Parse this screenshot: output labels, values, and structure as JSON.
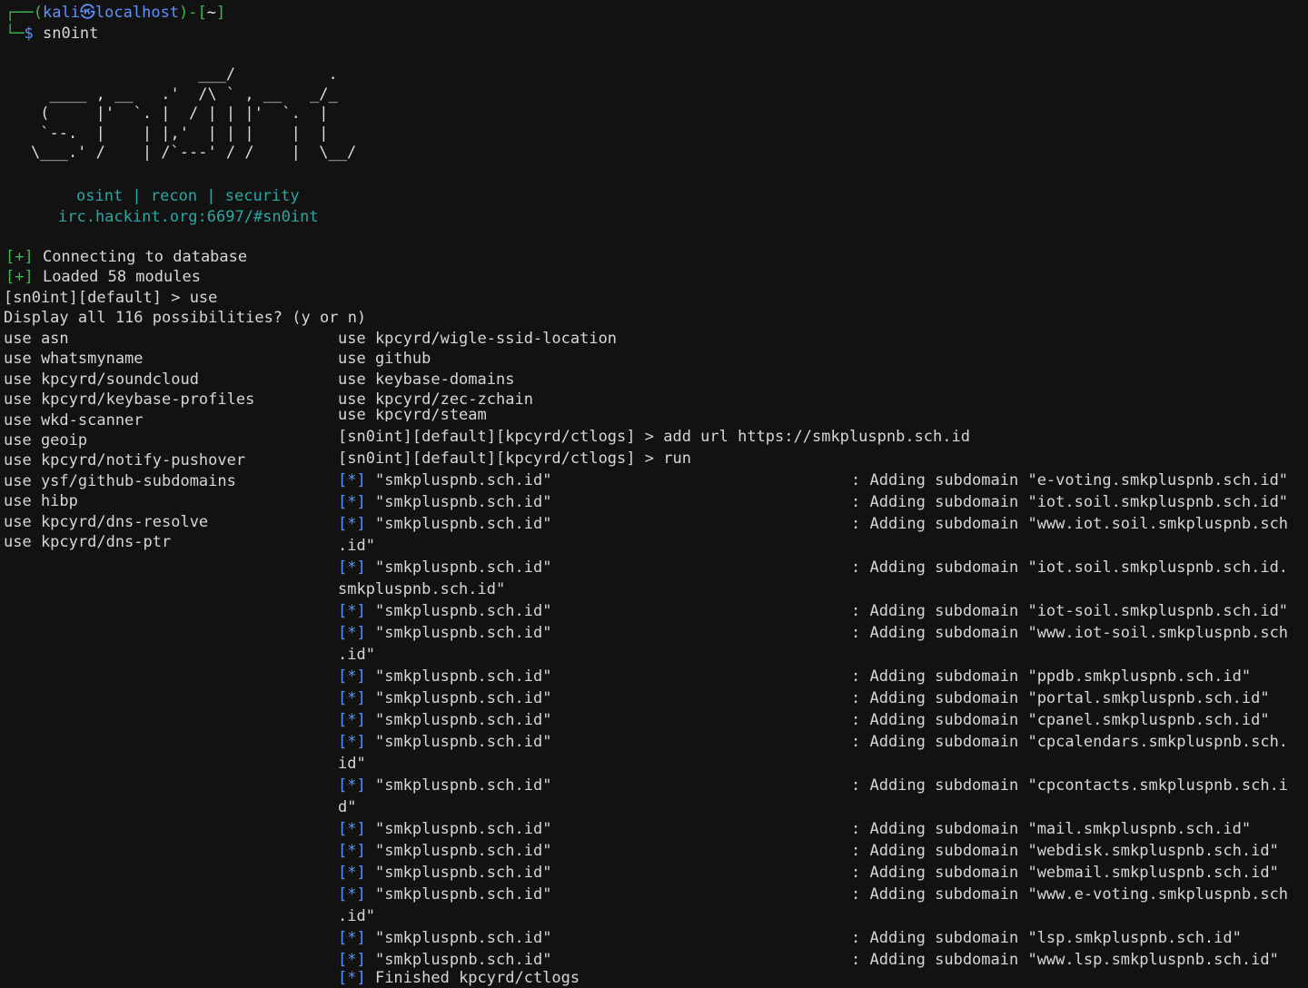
{
  "prompt": {
    "corner": "┌──",
    "user": "kali",
    "at": "㉿",
    "host": "localhost",
    "dir": "~",
    "cmd_corner": "└─",
    "dollar": "$",
    "command": "sn0int"
  },
  "banner": {
    "ascii_art": "                  ___/          .\n  ____ , __   .'  /\\ ` , __   _/_\n (     |'  `. |  / | | |'  `.  |\n `--.  |    | |,'  | | |    |  |\n\\___.' /    | /`---' / /    |  \\__/",
    "tagline": "osint | recon | security",
    "irc": "irc.hackint.org:6697/#sn0int"
  },
  "startup": {
    "marker": "[+]",
    "connecting": " Connecting to database",
    "loaded": " Loaded 58 modules",
    "prompt_use": "[sn0int][default] > use",
    "display_all": "Display all 116 possibilities? (y or n)"
  },
  "completions": {
    "left": [
      "use asn",
      "use whatsmyname",
      "use kpcyrd/soundcloud",
      "use kpcyrd/keybase-profiles",
      "use wkd-scanner",
      "use geoip",
      "use kpcyrd/notify-pushover",
      "use ysf/github-subdomains",
      "use hibp",
      "use kpcyrd/dns-resolve",
      "use kpcyrd/dns-ptr"
    ],
    "right": [
      "use kpcyrd/wigle-ssid-location",
      "use github",
      "use keybase-domains",
      "use kpcyrd/zec-zchain",
      "use kpcyrd/steam"
    ]
  },
  "session": {
    "add_url": "[sn0int][default][kpcyrd/ctlogs] > add url https://smkpluspnb.sch.id",
    "run": "[sn0int][default][kpcyrd/ctlogs] > run",
    "marker": "[*]",
    "domain": "\"smkpluspnb.sch.id\"",
    "log_lines": [
      {
        "text": ": Adding subdomain \"e-voting.smkpluspnb.sch.id\"",
        "wrap": ""
      },
      {
        "text": ": Adding subdomain \"iot.soil.smkpluspnb.sch.id\"",
        "wrap": ""
      },
      {
        "text": ": Adding subdomain \"www.iot.soil.smkpluspnb.sch",
        "wrap": ".id\""
      },
      {
        "text": ": Adding subdomain \"iot.soil.smkpluspnb.sch.id.",
        "wrap": "smkpluspnb.sch.id\""
      },
      {
        "text": ": Adding subdomain \"iot-soil.smkpluspnb.sch.id\"",
        "wrap": ""
      },
      {
        "text": ": Adding subdomain \"www.iot-soil.smkpluspnb.sch",
        "wrap": ".id\""
      },
      {
        "text": ": Adding subdomain \"ppdb.smkpluspnb.sch.id\"",
        "wrap": ""
      },
      {
        "text": ": Adding subdomain \"portal.smkpluspnb.sch.id\"",
        "wrap": ""
      },
      {
        "text": ": Adding subdomain \"cpanel.smkpluspnb.sch.id\"",
        "wrap": ""
      },
      {
        "text": ": Adding subdomain \"cpcalendars.smkpluspnb.sch.",
        "wrap": "id\""
      },
      {
        "text": ": Adding subdomain \"cpcontacts.smkpluspnb.sch.i",
        "wrap": "d\""
      },
      {
        "text": ": Adding subdomain \"mail.smkpluspnb.sch.id\"",
        "wrap": ""
      },
      {
        "text": ": Adding subdomain \"webdisk.smkpluspnb.sch.id\"",
        "wrap": ""
      },
      {
        "text": ": Adding subdomain \"webmail.smkpluspnb.sch.id\"",
        "wrap": ""
      },
      {
        "text": ": Adding subdomain \"www.e-voting.smkpluspnb.sch",
        "wrap": ".id\""
      },
      {
        "text": ": Adding subdomain \"lsp.smkpluspnb.sch.id\"",
        "wrap": ""
      },
      {
        "text": ": Adding subdomain \"www.lsp.smkpluspnb.sch.id\"",
        "wrap": ""
      }
    ],
    "finished": " Finished kpcyrd/ctlogs"
  }
}
